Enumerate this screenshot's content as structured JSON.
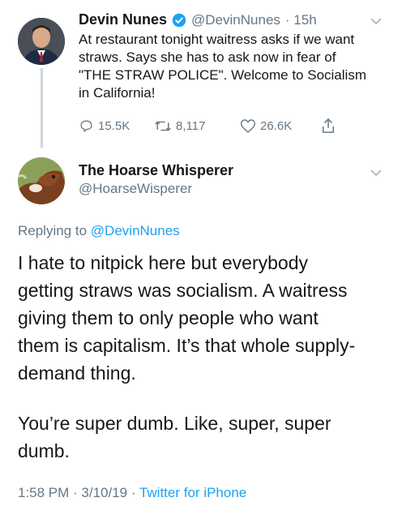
{
  "colors": {
    "accent": "#1da1f2",
    "muted": "#657786",
    "text": "#14171a",
    "thread_line": "#ccd6dd"
  },
  "original_tweet": {
    "author_name": "Devin Nunes",
    "handle": "@DevinNunes",
    "time": "· 15h",
    "verified_icon": "verified-badge-icon",
    "text": "At restaurant tonight waitress asks if we want\nstraws. Says she has to ask now in fear of\n\"THE STRAW POLICE\". Welcome to Socialism\nin California!",
    "actions": {
      "replies": "15.5K",
      "retweets": "8,117",
      "likes": "26.6K"
    }
  },
  "reply_tweet": {
    "author_name": "The Hoarse Whisperer",
    "handle": "@HoarseWisperer",
    "replying_to_label": "Replying to",
    "replying_to_handle": "@DevinNunes",
    "paragraph_1_lines": [
      "I hate to nitpick here but everybody",
      "getting straws was socialism. A waitress",
      "giving them to only people who want",
      "them is capitalism. It’s that whole supply-",
      "demand thing."
    ],
    "paragraph_2_lines": [
      "You’re super dumb. Like, super, super",
      "dumb."
    ],
    "timestamp": "1:58 PM · 3/10/19 ·",
    "source": "Twitter for iPhone"
  }
}
